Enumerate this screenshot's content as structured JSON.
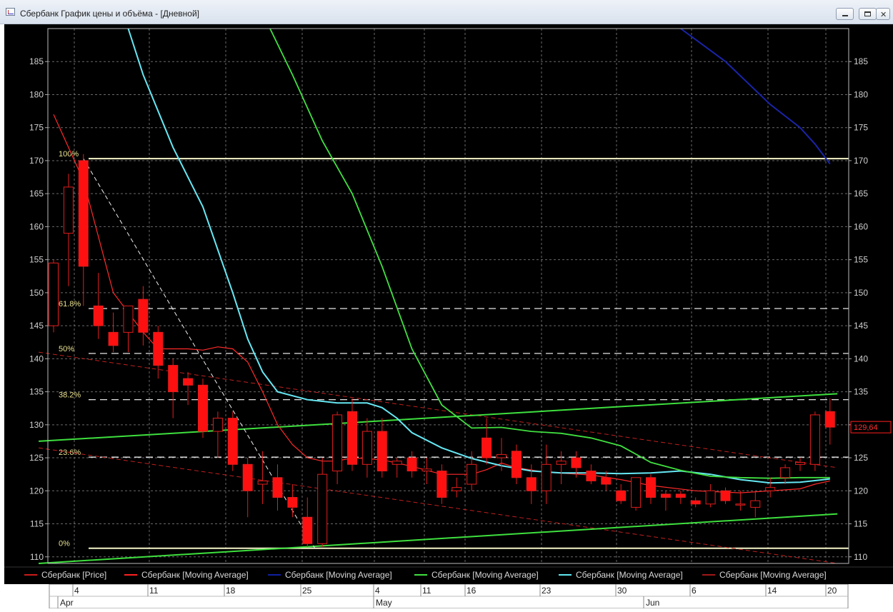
{
  "window": {
    "title": "Сбербанк График цены и объёма - [Дневной]",
    "close_glyph": "✕"
  },
  "legend": [
    {
      "label": "Сбербанк [Price]",
      "color": "#cc1b1b"
    },
    {
      "label": "Сбербанк [Moving Average]",
      "color": "#ff2020"
    },
    {
      "label": "Сбербанк [Moving Average]",
      "color": "#1020a0"
    },
    {
      "label": "Сбербанк [Moving Average]",
      "color": "#40e040"
    },
    {
      "label": "Сбербанк [Moving Average]",
      "color": "#60e8f0"
    },
    {
      "label": "Сбербанк [Moving Average]",
      "color": "#a01818"
    }
  ],
  "chart_data": {
    "type": "candlestick",
    "title": "Сбербанк График цены и объёма - [Дневной]",
    "ylim": [
      109,
      190
    ],
    "y_ticks": [
      110,
      115,
      120,
      125,
      130,
      135,
      140,
      145,
      150,
      155,
      160,
      165,
      170,
      175,
      180,
      185
    ],
    "grid": true,
    "last_price_label": "129,64",
    "x_day_labels": [
      "4",
      "11",
      "18",
      "25",
      "4",
      "11",
      "16",
      "23",
      "30",
      "6",
      "14",
      "20"
    ],
    "x_month_labels": [
      "Apr",
      "May",
      "Jun"
    ],
    "candles": [
      {
        "o": 145,
        "h": 155,
        "l": 144,
        "c": 154.5
      },
      {
        "o": 159,
        "h": 168,
        "l": 151,
        "c": 166
      },
      {
        "o": 170,
        "h": 171,
        "l": 148,
        "c": 154
      },
      {
        "o": 148,
        "h": 153,
        "l": 143,
        "c": 145
      },
      {
        "o": 144,
        "h": 147,
        "l": 141,
        "c": 142
      },
      {
        "o": 144,
        "h": 148,
        "l": 141,
        "c": 148
      },
      {
        "o": 149,
        "h": 151,
        "l": 142,
        "c": 144
      },
      {
        "o": 144,
        "h": 145,
        "l": 137,
        "c": 139
      },
      {
        "o": 139,
        "h": 140,
        "l": 131,
        "c": 135
      },
      {
        "o": 137,
        "h": 138,
        "l": 133,
        "c": 136
      },
      {
        "o": 136,
        "h": 137,
        "l": 128,
        "c": 129
      },
      {
        "o": 129,
        "h": 132,
        "l": 125,
        "c": 131
      },
      {
        "o": 131,
        "h": 132,
        "l": 123,
        "c": 124
      },
      {
        "o": 124,
        "h": 125,
        "l": 116,
        "c": 120
      },
      {
        "o": 121,
        "h": 126,
        "l": 118,
        "c": 121.5
      },
      {
        "o": 122,
        "h": 124,
        "l": 117,
        "c": 119
      },
      {
        "o": 119,
        "h": 121,
        "l": 116,
        "c": 117.5
      },
      {
        "o": 116,
        "h": 119,
        "l": 111.5,
        "c": 112
      },
      {
        "o": 112,
        "h": 125,
        "l": 111.5,
        "c": 122.5
      },
      {
        "o": 123,
        "h": 132,
        "l": 121,
        "c": 131.5
      },
      {
        "o": 132,
        "h": 134,
        "l": 123,
        "c": 124
      },
      {
        "o": 124,
        "h": 131,
        "l": 122,
        "c": 129
      },
      {
        "o": 129,
        "h": 131,
        "l": 122,
        "c": 123
      },
      {
        "o": 124,
        "h": 125,
        "l": 122,
        "c": 124.5
      },
      {
        "o": 125,
        "h": 126,
        "l": 122,
        "c": 123
      },
      {
        "o": 123,
        "h": 125,
        "l": 121,
        "c": 123.3
      },
      {
        "o": 123,
        "h": 124,
        "l": 118,
        "c": 119
      },
      {
        "o": 120,
        "h": 122,
        "l": 119,
        "c": 120.5
      },
      {
        "o": 121,
        "h": 126,
        "l": 120,
        "c": 124
      },
      {
        "o": 128,
        "h": 131,
        "l": 124,
        "c": 125
      },
      {
        "o": 125,
        "h": 128,
        "l": 123,
        "c": 125.5
      },
      {
        "o": 126,
        "h": 127,
        "l": 121,
        "c": 122
      },
      {
        "o": 122,
        "h": 124,
        "l": 118,
        "c": 120
      },
      {
        "o": 120,
        "h": 127,
        "l": 118,
        "c": 124
      },
      {
        "o": 124,
        "h": 126,
        "l": 121,
        "c": 124.5
      },
      {
        "o": 125,
        "h": 126,
        "l": 122,
        "c": 123.5
      },
      {
        "o": 123,
        "h": 124,
        "l": 121,
        "c": 121.5
      },
      {
        "o": 122,
        "h": 123,
        "l": 120,
        "c": 121
      },
      {
        "o": 120,
        "h": 121,
        "l": 118,
        "c": 118.5
      },
      {
        "o": 117.5,
        "h": 122,
        "l": 117,
        "c": 122
      },
      {
        "o": 122,
        "h": 122.5,
        "l": 118,
        "c": 119
      },
      {
        "o": 119.5,
        "h": 120,
        "l": 117,
        "c": 119
      },
      {
        "o": 119.5,
        "h": 120,
        "l": 118,
        "c": 119
      },
      {
        "o": 118.5,
        "h": 119,
        "l": 117.5,
        "c": 118
      },
      {
        "o": 118,
        "h": 121,
        "l": 117.5,
        "c": 120
      },
      {
        "o": 120,
        "h": 120.5,
        "l": 118,
        "c": 118.5
      },
      {
        "o": 118,
        "h": 120,
        "l": 117,
        "c": 118
      },
      {
        "o": 117.5,
        "h": 120,
        "l": 116,
        "c": 118.5
      },
      {
        "o": 120,
        "h": 122,
        "l": 119,
        "c": 120.5
      },
      {
        "o": 122,
        "h": 124,
        "l": 121,
        "c": 123.5
      },
      {
        "o": 124,
        "h": 125,
        "l": 123,
        "c": 124.3
      },
      {
        "o": 124,
        "h": 132,
        "l": 123,
        "c": 131.5
      },
      {
        "o": 132,
        "h": 134,
        "l": 127,
        "c": 129.64
      }
    ],
    "fibonacci": [
      {
        "label": "100%",
        "value": 170.3
      },
      {
        "label": "61.8%",
        "value": 147.6
      },
      {
        "label": "50%",
        "value": 140.8
      },
      {
        "label": "38.2%",
        "value": 133.8
      },
      {
        "label": "23.6%",
        "value": 125.1
      },
      {
        "label": "0%",
        "value": 111.3
      }
    ],
    "moving_averages": {
      "red": [
        [
          0,
          177
        ],
        [
          2,
          167
        ],
        [
          4,
          150
        ],
        [
          6,
          144
        ],
        [
          7,
          141.5
        ],
        [
          9,
          141.5
        ],
        [
          10,
          141.3
        ],
        [
          11,
          141.8
        ],
        [
          12,
          141.5
        ],
        [
          13,
          139.5
        ],
        [
          14,
          135
        ],
        [
          15,
          130
        ],
        [
          16,
          127
        ],
        [
          17,
          125
        ],
        [
          18,
          124.5
        ],
        [
          19,
          124.5
        ],
        [
          20,
          125
        ],
        [
          22,
          124.7
        ],
        [
          24,
          123.7
        ],
        [
          26,
          122.5
        ],
        [
          28,
          122.5
        ],
        [
          29,
          123.2
        ],
        [
          30,
          124.2
        ],
        [
          31,
          123.5
        ],
        [
          33,
          122.8
        ],
        [
          36,
          122.4
        ],
        [
          38,
          121.7
        ],
        [
          40,
          120.8
        ],
        [
          43,
          120
        ],
        [
          46,
          119.7
        ],
        [
          48,
          120
        ],
        [
          50,
          120.3
        ],
        [
          51,
          121
        ],
        [
          52,
          121.5
        ]
      ],
      "cyan": [
        [
          5,
          190
        ],
        [
          6,
          183
        ],
        [
          8,
          172
        ],
        [
          10,
          163
        ],
        [
          12,
          150
        ],
        [
          13,
          143
        ],
        [
          14,
          138
        ],
        [
          15,
          135
        ],
        [
          17,
          133.8
        ],
        [
          19,
          133.3
        ],
        [
          21,
          133.3
        ],
        [
          22,
          132.6
        ],
        [
          23,
          131
        ],
        [
          24,
          128.8
        ],
        [
          26,
          126.5
        ],
        [
          28,
          124.9
        ],
        [
          30,
          123.8
        ],
        [
          32,
          123
        ],
        [
          34,
          122.7
        ],
        [
          36,
          122.7
        ],
        [
          38,
          122.6
        ],
        [
          40,
          122.7
        ],
        [
          42,
          123
        ],
        [
          44,
          122.5
        ],
        [
          46,
          121.7
        ],
        [
          48,
          121.2
        ],
        [
          50,
          121.3
        ],
        [
          52,
          121.8
        ]
      ],
      "green": [
        [
          14.5,
          190
        ],
        [
          16,
          183
        ],
        [
          18,
          173
        ],
        [
          20,
          165
        ],
        [
          22,
          154
        ],
        [
          24,
          141.5
        ],
        [
          26,
          133
        ],
        [
          28,
          129.5
        ],
        [
          30,
          129.6
        ],
        [
          32,
          129
        ],
        [
          34,
          128.7
        ],
        [
          36,
          128
        ],
        [
          38,
          126.8
        ],
        [
          40,
          124.3
        ],
        [
          42,
          123.1
        ],
        [
          44,
          122.2
        ],
        [
          46,
          122
        ],
        [
          48,
          121.9
        ],
        [
          50,
          122
        ],
        [
          52,
          122
        ]
      ],
      "navy": [
        [
          42,
          190
        ],
        [
          45,
          185
        ],
        [
          48,
          178.5
        ],
        [
          50,
          175
        ],
        [
          51,
          172.5
        ],
        [
          52,
          169.5
        ]
      ],
      "darkred": []
    },
    "trend_lines": {
      "green_upper": {
        "from": [
          -1,
          127.5
        ],
        "to": [
          52.5,
          134.7
        ]
      },
      "green_lower": {
        "from": [
          -1,
          109
        ],
        "to": [
          52.5,
          116.5
        ]
      },
      "red_upper": {
        "from": [
          -1,
          141
        ],
        "to": [
          52.5,
          123.5
        ]
      },
      "red_lower": {
        "from": [
          -1,
          126.5
        ],
        "to": [
          52.5,
          109
        ]
      },
      "fib_diagonal": {
        "from": [
          2,
          170.3
        ],
        "to": [
          17.5,
          111.3
        ]
      }
    }
  }
}
